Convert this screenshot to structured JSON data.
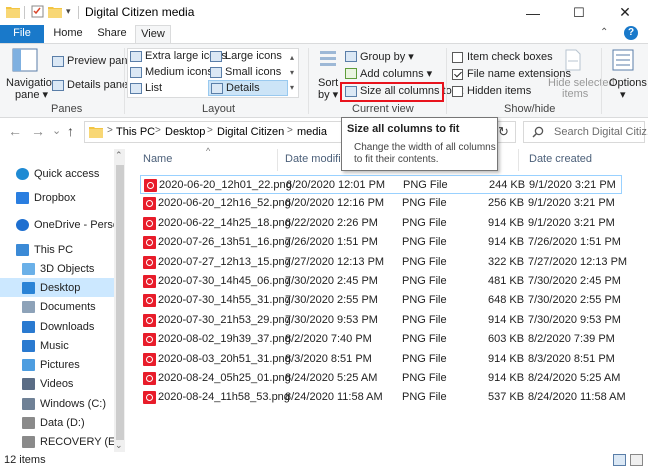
{
  "window": {
    "title": "Digital Citizen media",
    "minimize_glyph": "—",
    "maximize_glyph": "☐",
    "close_glyph": "✕"
  },
  "ribbon_tabs": [
    "File",
    "Home",
    "Share",
    "View"
  ],
  "ribbon": {
    "panes": {
      "label": "Panes",
      "navigation_pane": "Navigation",
      "navigation_pane_2": "pane ▾",
      "preview_pane": "Preview pane",
      "details_pane": "Details pane"
    },
    "layout": {
      "label": "Layout",
      "items": [
        "Extra large icons",
        "Large icons",
        "Medium icons",
        "Small icons",
        "List",
        "Details"
      ]
    },
    "current_view": {
      "label": "Current view",
      "sort_by": "Sort",
      "sort_by_2": "by ▾",
      "group_by": "Group by ▾",
      "add_columns": "Add columns ▾",
      "size_all_columns": "Size all columns to fit"
    },
    "show_hide": {
      "label": "Show/hide",
      "item_check_boxes": "Item check boxes",
      "file_name_extensions": "File name extensions",
      "hidden_items": "Hidden items",
      "hide_selected": "Hide selected",
      "hide_selected_2": "items"
    },
    "options": "Options",
    "options_caret": "▾",
    "collapse_glyph": "⌃",
    "help_glyph": "?"
  },
  "address_bar": {
    "back": "←",
    "forward": "→",
    "recent": "⌄",
    "up": "↑",
    "crumbs": [
      "This PC",
      "Desktop",
      "Digital Citizen"
    ],
    "crumb_sep": ">",
    "crumb_tail": "media",
    "refresh": "↻",
    "search_placeholder": "Search Digital Citiz..."
  },
  "tooltip": {
    "title": "Size all columns to fit",
    "description": "Change the width of all columns to fit their contents."
  },
  "nav_pane": [
    {
      "label": "Quick access",
      "icon": "star-icon",
      "color": "#1f8ad3"
    },
    {
      "label": "Dropbox",
      "icon": "dropbox-icon",
      "color": "#2a7ee0"
    },
    {
      "label": "OneDrive - Person",
      "icon": "cloud-icon",
      "color": "#1e6fd0"
    },
    {
      "label": "This PC",
      "icon": "computer-icon",
      "color": "#3b8ad6"
    },
    {
      "label": "3D Objects",
      "icon": "cube-icon",
      "color": "#6ab0e8"
    },
    {
      "label": "Desktop",
      "icon": "desktop-icon",
      "color": "#2a83d6"
    },
    {
      "label": "Documents",
      "icon": "documents-icon",
      "color": "#8da2b8"
    },
    {
      "label": "Downloads",
      "icon": "download-icon",
      "color": "#2a7ad0"
    },
    {
      "label": "Music",
      "icon": "music-icon",
      "color": "#2a7ad0"
    },
    {
      "label": "Pictures",
      "icon": "pictures-icon",
      "color": "#4d9de0"
    },
    {
      "label": "Videos",
      "icon": "videos-icon",
      "color": "#5a6c85"
    },
    {
      "label": "Windows (C:)",
      "icon": "drive-icon",
      "color": "#6f8196"
    },
    {
      "label": "Data (D:)",
      "icon": "drive-icon",
      "color": "#8a8a8a"
    },
    {
      "label": "RECOVERY (E:)",
      "icon": "drive-icon",
      "color": "#8a8a8a"
    }
  ],
  "nav_scroll": {
    "up": "⌃",
    "down": "⌄"
  },
  "columns": [
    "Name",
    "Date modified",
    "Type",
    "Size",
    "Date created"
  ],
  "sort_arrow": "^",
  "files": [
    {
      "name": "2020-06-20_12h01_22.png",
      "modified": "6/20/2020 12:01 PM",
      "type": "PNG File",
      "size": "244 KB",
      "created": "9/1/2020 3:21 PM"
    },
    {
      "name": "2020-06-20_12h16_52.png",
      "modified": "6/20/2020 12:16 PM",
      "type": "PNG File",
      "size": "256 KB",
      "created": "9/1/2020 3:21 PM"
    },
    {
      "name": "2020-06-22_14h25_18.png",
      "modified": "6/22/2020 2:26 PM",
      "type": "PNG File",
      "size": "914 KB",
      "created": "9/1/2020 3:21 PM"
    },
    {
      "name": "2020-07-26_13h51_16.png",
      "modified": "7/26/2020 1:51 PM",
      "type": "PNG File",
      "size": "914 KB",
      "created": "7/26/2020 1:51 PM"
    },
    {
      "name": "2020-07-27_12h13_15.png",
      "modified": "7/27/2020 12:13 PM",
      "type": "PNG File",
      "size": "322 KB",
      "created": "7/27/2020 12:13 PM"
    },
    {
      "name": "2020-07-30_14h45_06.png",
      "modified": "7/30/2020 2:45 PM",
      "type": "PNG File",
      "size": "481 KB",
      "created": "7/30/2020 2:45 PM"
    },
    {
      "name": "2020-07-30_14h55_31.png",
      "modified": "7/30/2020 2:55 PM",
      "type": "PNG File",
      "size": "648 KB",
      "created": "7/30/2020 2:55 PM"
    },
    {
      "name": "2020-07-30_21h53_29.png",
      "modified": "7/30/2020 9:53 PM",
      "type": "PNG File",
      "size": "914 KB",
      "created": "7/30/2020 9:53 PM"
    },
    {
      "name": "2020-08-02_19h39_37.png",
      "modified": "8/2/2020 7:40 PM",
      "type": "PNG File",
      "size": "603 KB",
      "created": "8/2/2020 7:39 PM"
    },
    {
      "name": "2020-08-03_20h51_31.png",
      "modified": "8/3/2020 8:51 PM",
      "type": "PNG File",
      "size": "914 KB",
      "created": "8/3/2020 8:51 PM"
    },
    {
      "name": "2020-08-24_05h25_01.png",
      "modified": "8/24/2020 5:25 AM",
      "type": "PNG File",
      "size": "914 KB",
      "created": "8/24/2020 5:25 AM"
    },
    {
      "name": "2020-08-24_11h58_53.png",
      "modified": "8/24/2020 11:58 AM",
      "type": "PNG File",
      "size": "537 KB",
      "created": "8/24/2020 11:58 AM"
    }
  ],
  "status": {
    "items_count": "12 items"
  }
}
